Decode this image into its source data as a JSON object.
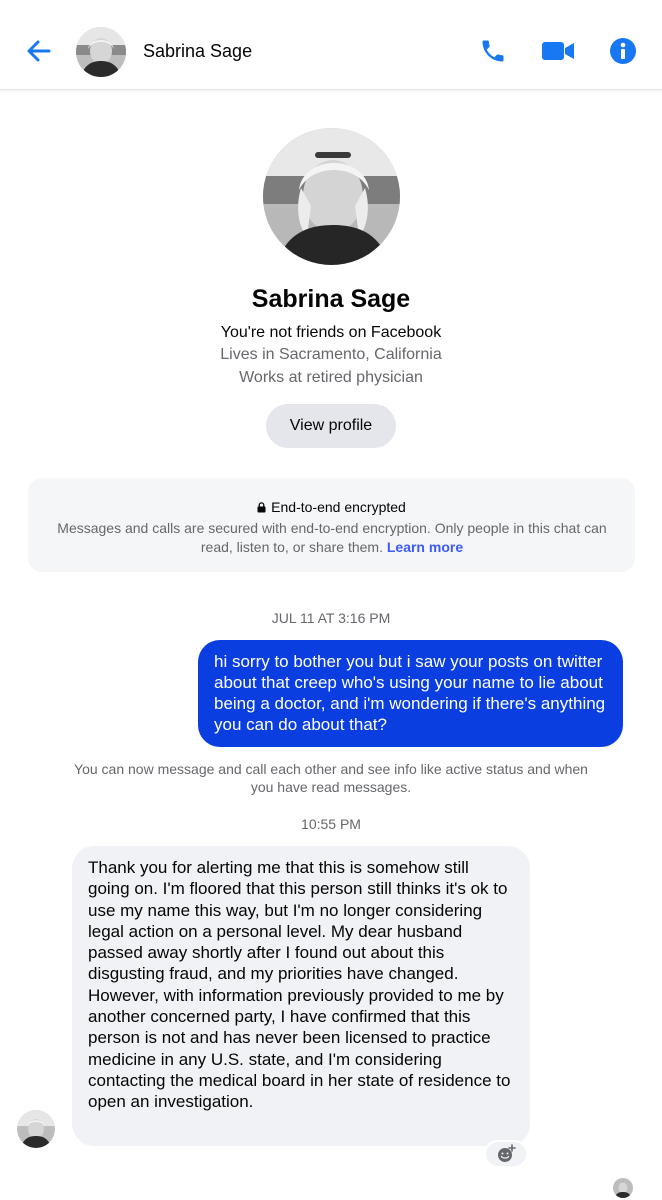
{
  "header": {
    "contact_name": "Sabrina Sage",
    "icons": [
      "back-arrow-icon",
      "phone-icon",
      "video-camera-icon",
      "info-icon"
    ],
    "accent_color": "#1877f2"
  },
  "profile": {
    "name": "Sabrina Sage",
    "friend_status": "You're not friends on Facebook",
    "location": "Lives in Sacramento, California",
    "work": "Works at retired physician",
    "view_profile_label": "View profile"
  },
  "encryption": {
    "title": "End-to-end encrypted",
    "body": "Messages and calls are secured with end-to-end encryption. Only people in this chat can read, listen to, or share them.",
    "link": "Learn more"
  },
  "thread": {
    "timestamp_1": "JUL 11 AT 3:16 PM",
    "outgoing_message": "hi sorry to bother you but i saw your posts on twitter about that creep who's using your name to lie about being a doctor, and i'm wondering if there's anything you can do about that?",
    "system_notice": "You can now message and call each other and see info like active status and when you have read messages.",
    "timestamp_2": "10:55 PM",
    "incoming_message": "Thank you for alerting me that this is somehow still going on. I'm floored that this person still thinks it's ok to use my name this way, but I'm no longer considering legal action on a personal level. My dear husband passed away shortly after I found out about this disgusting fraud, and my priorities have changed.\nHowever, with information previously provided to me by another concerned party, I have confirmed that this person is not and has never been licensed to practice medicine in any U.S. state, and I'm considering contacting the medical board in her state of residence to open an investigation.",
    "outgoing_bubble_color": "#0a3ee0",
    "incoming_bubble_color": "#f0f2f5"
  }
}
